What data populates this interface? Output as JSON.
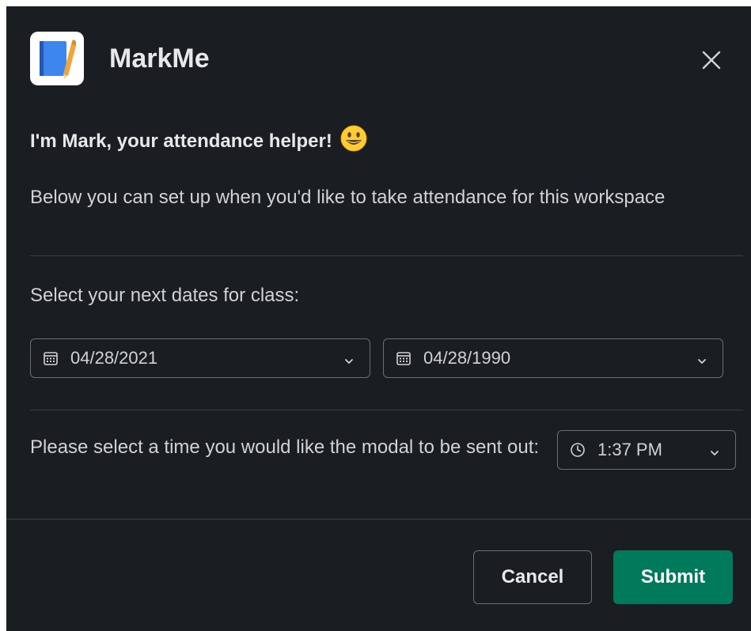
{
  "app": {
    "title": "MarkMe",
    "icon": "notebook-pencil-icon"
  },
  "intro": {
    "heading": "I'm Mark, your attendance helper!",
    "emoji": "smiley-emoji",
    "description": "Below you can set up when you'd like to take attendance for this workspace"
  },
  "dates": {
    "label": "Select your next dates for class:",
    "start_date": "04/28/2021",
    "end_date": "04/28/1990"
  },
  "time": {
    "label": "Please select a time you would like the modal to be sent out:",
    "value": "1:37 PM"
  },
  "footer": {
    "cancel_label": "Cancel",
    "submit_label": "Submit"
  },
  "colors": {
    "background": "#1a1d21",
    "submit": "#007a5a",
    "text": "#d1d2d3"
  }
}
